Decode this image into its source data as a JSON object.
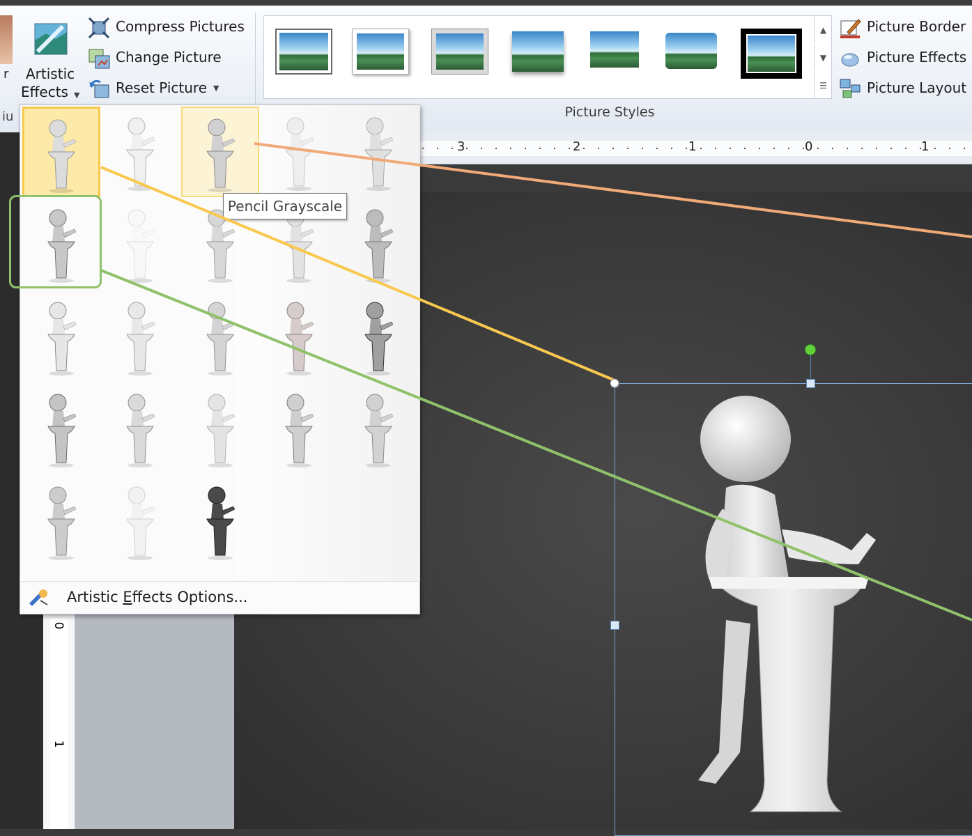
{
  "ribbon": {
    "artistic_effects_label_1": "Artistic",
    "artistic_effects_label_2": "Effects",
    "compress_label": "Compress Pictures",
    "change_label": "Change Picture",
    "reset_label": "Reset Picture",
    "picture_border": "Picture Border",
    "picture_effects": "Picture Effects",
    "picture_layout": "Picture Layout",
    "styles_group_label": "Picture Styles"
  },
  "ruler": {
    "horizontal_numbers": [
      "3",
      "2",
      "1",
      "0",
      "1"
    ],
    "vertical_numbers": [
      "0",
      "1"
    ]
  },
  "artistic_effects": {
    "tooltip": "Pencil Grayscale",
    "options_label": "Artistic Effects Options...",
    "options_mnemonic": "E"
  },
  "colors": {
    "highlight_orange": "#f6c84c",
    "callout_green": "#8fc26b",
    "callout_orange": "#f0aa78",
    "callout_yellow": "#f9c84f",
    "slide_bg": "#3a3a3a"
  }
}
